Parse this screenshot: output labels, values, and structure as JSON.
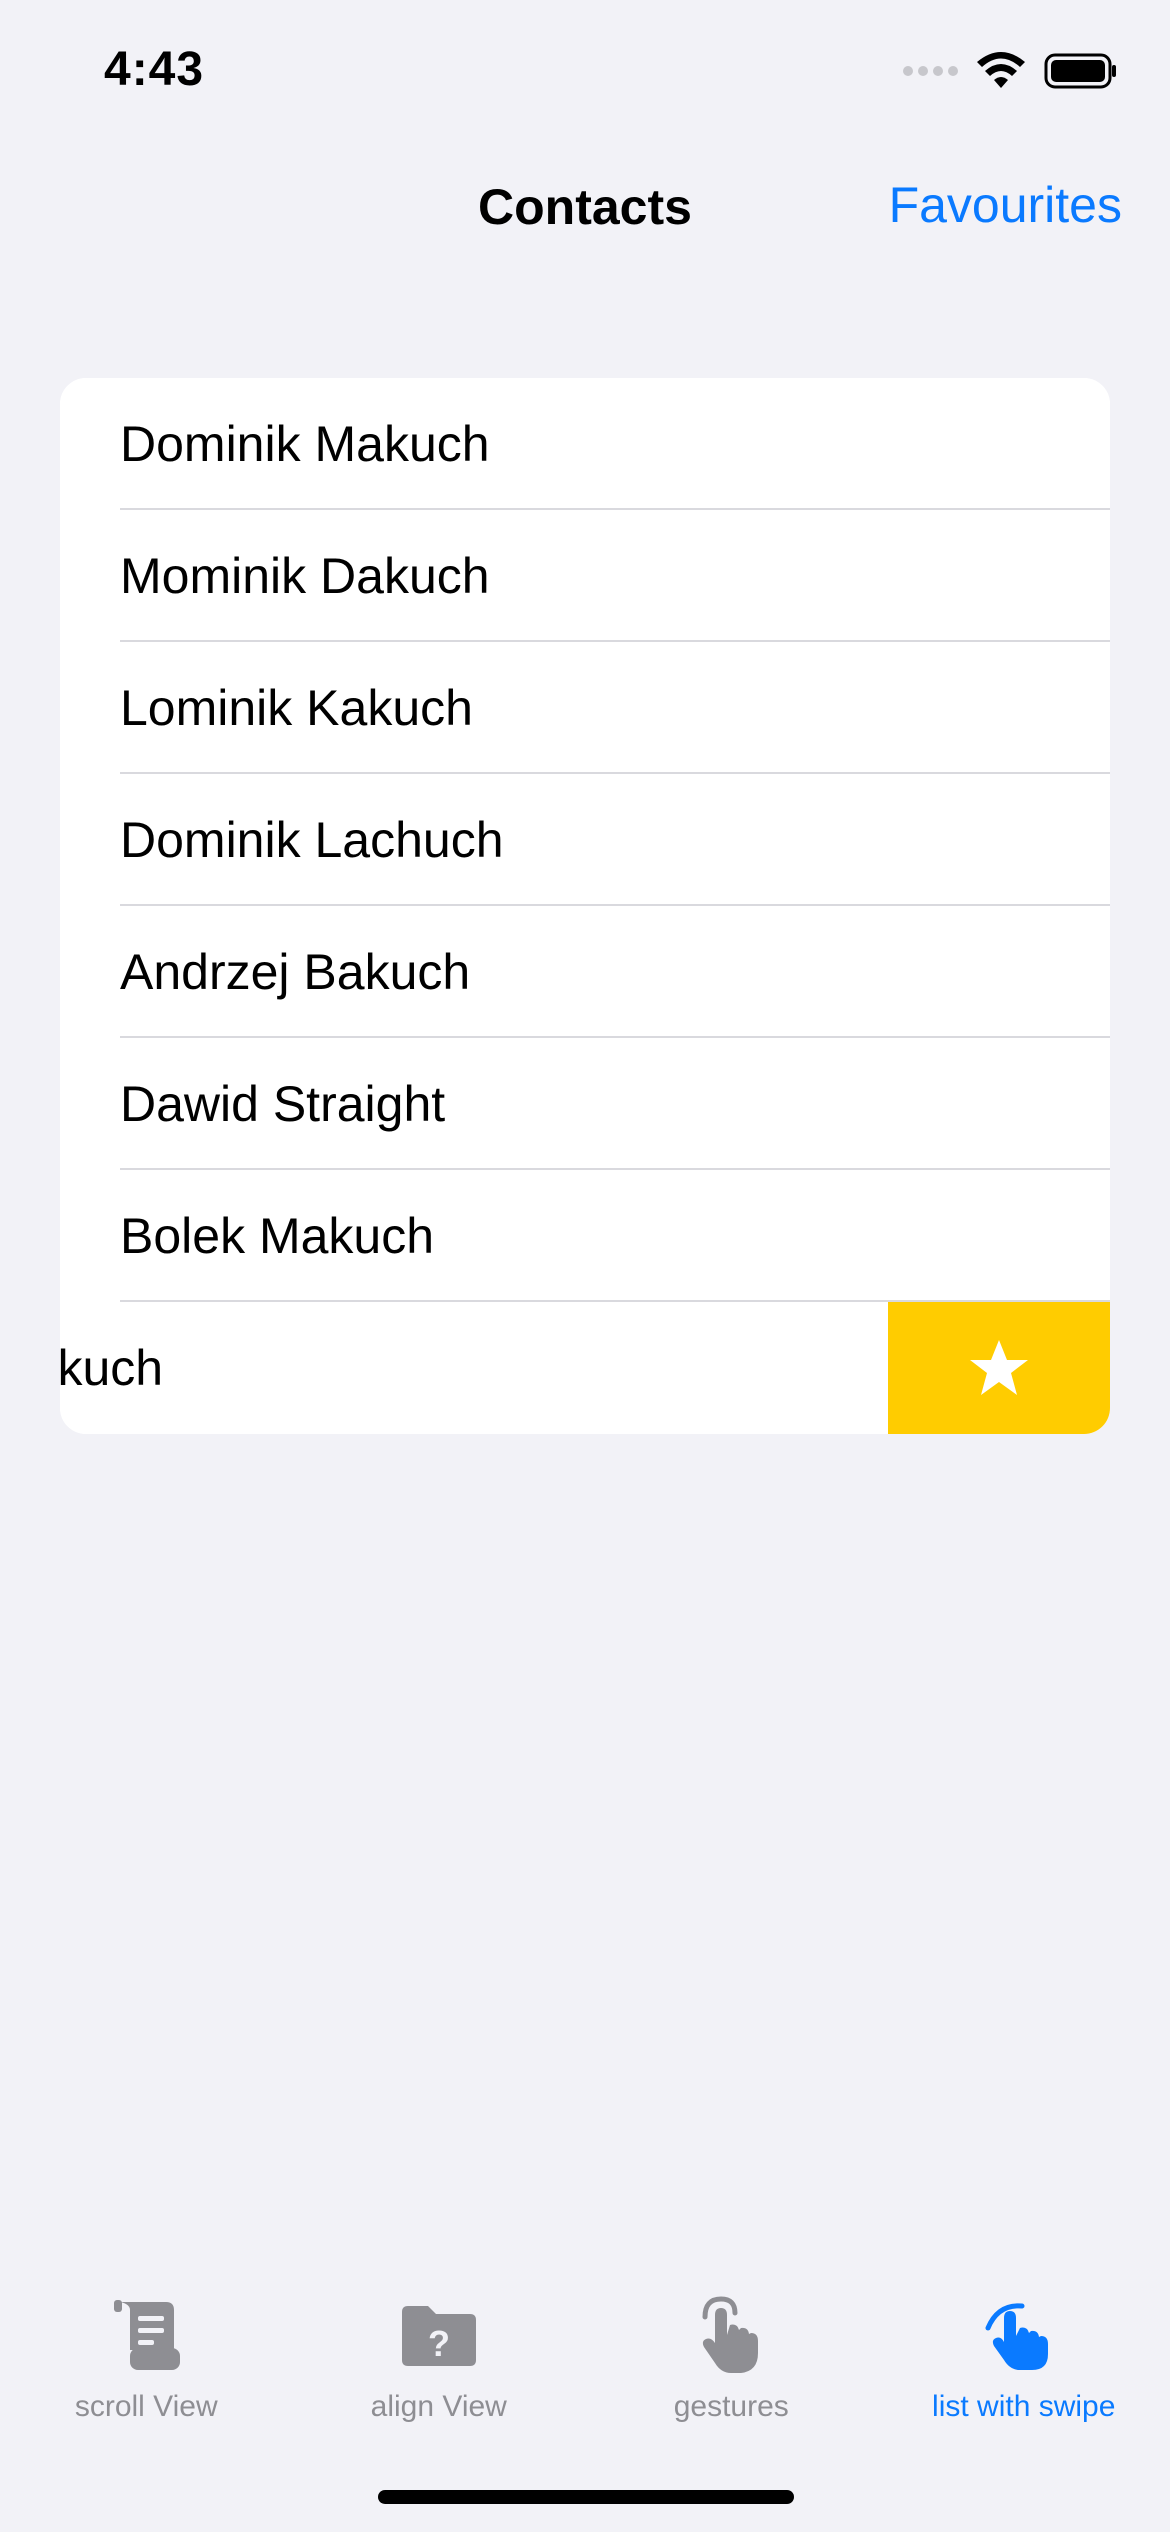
{
  "status": {
    "time": "4:43"
  },
  "nav": {
    "title": "Contacts",
    "action": "Favourites"
  },
  "contacts": [
    "Dominik Makuch",
    "Mominik Dakuch",
    "Lominik Kakuch",
    "Dominik Lachuch",
    "Andrzej Bakuch",
    "Dawid Straight",
    "Bolek Makuch",
    "Makuch"
  ],
  "swipe": {
    "row_index": 7,
    "action_icon": "star-icon",
    "action_color": "#ffcc00"
  },
  "tabs": [
    {
      "label": "scroll View",
      "icon": "scroll-icon",
      "active": false
    },
    {
      "label": "align View",
      "icon": "folder-question-icon",
      "active": false
    },
    {
      "label": "gestures",
      "icon": "hand-tap-icon",
      "active": false
    },
    {
      "label": "list with swipe",
      "icon": "hand-swipe-icon",
      "active": true
    }
  ],
  "colors": {
    "accent": "#0a7aff",
    "inactive": "#8e8e93",
    "background": "#f2f2f7"
  }
}
